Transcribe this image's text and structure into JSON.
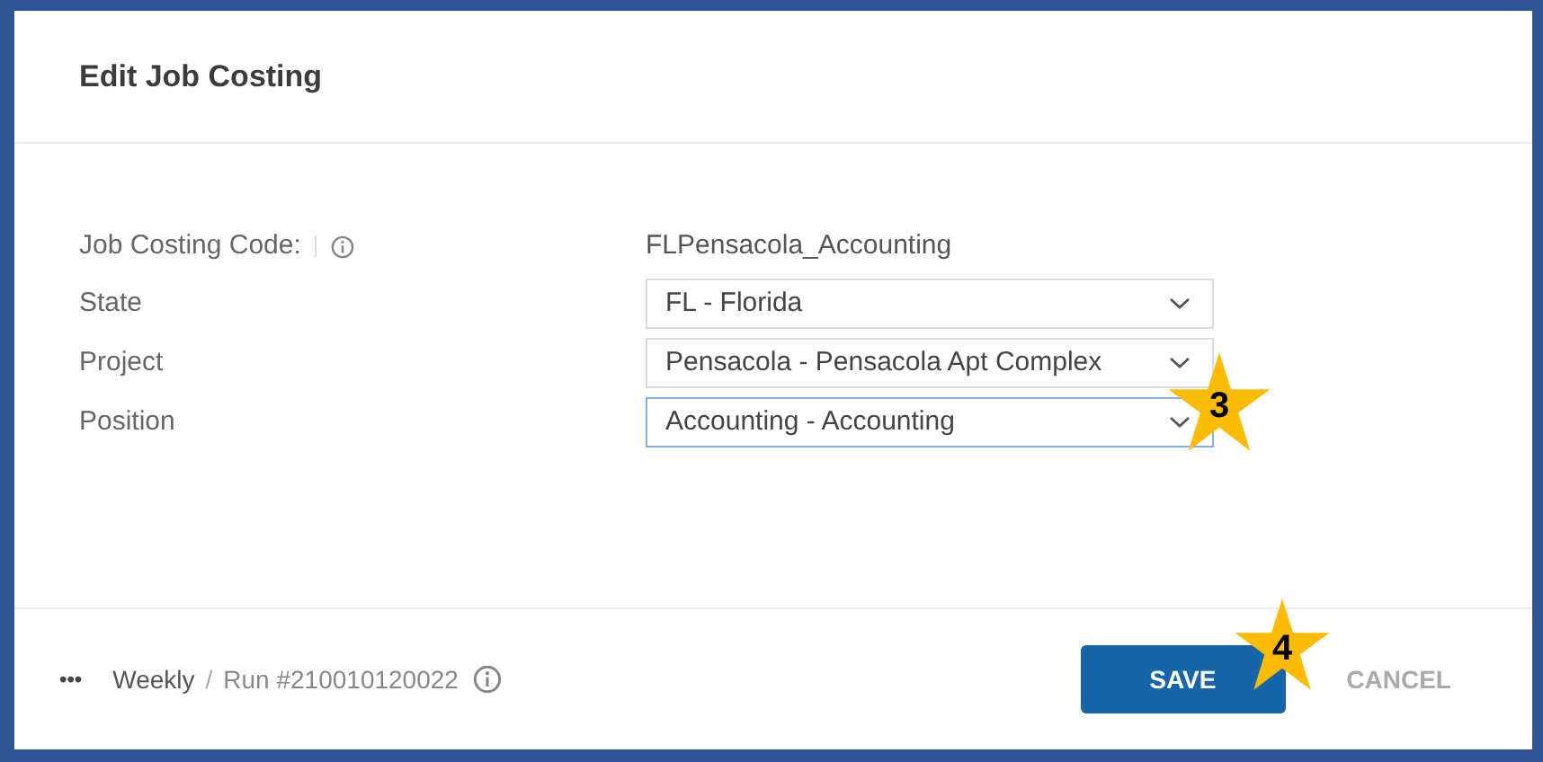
{
  "dialog": {
    "title": "Edit Job Costing"
  },
  "code_field": {
    "label": "Job Costing Code:",
    "value": "FLPensacola_Accounting"
  },
  "fields": [
    {
      "label": "State",
      "value": "FL - Florida",
      "focused": false
    },
    {
      "label": "Project",
      "value": "Pensacola - Pensacola Apt Complex",
      "focused": false
    },
    {
      "label": "Position",
      "value": "Accounting - Accounting",
      "focused": true
    }
  ],
  "footer": {
    "more": "•••",
    "schedule": "Weekly",
    "separator": "/",
    "run": "Run #210010120022"
  },
  "buttons": {
    "save": "SAVE",
    "cancel": "CANCEL"
  },
  "callouts": [
    {
      "number": "3"
    },
    {
      "number": "4"
    }
  ]
}
